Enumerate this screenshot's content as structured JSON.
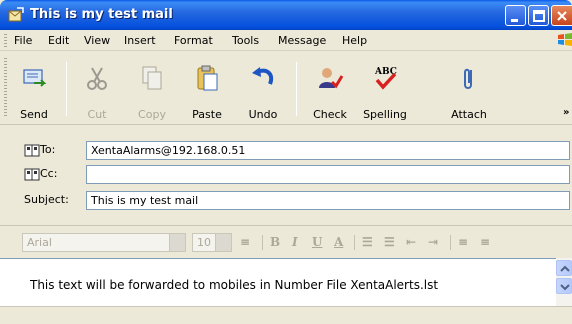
{
  "window": {
    "title": "This is my test mail"
  },
  "menu": {
    "items": [
      {
        "label": "File"
      },
      {
        "label": "Edit"
      },
      {
        "label": "View"
      },
      {
        "label": "Insert"
      },
      {
        "label": "Format"
      },
      {
        "label": "Tools"
      },
      {
        "label": "Message"
      },
      {
        "label": "Help"
      }
    ]
  },
  "toolbar": {
    "send": "Send",
    "cut": "Cut",
    "copy": "Copy",
    "paste": "Paste",
    "undo": "Undo",
    "check": "Check",
    "spelling": "Spelling",
    "spelling_icon_text": "ABC",
    "attach": "Attach"
  },
  "headers": {
    "to_label": "To:",
    "to_value": "XentaAlarms@192.168.0.51",
    "cc_label": "Cc:",
    "cc_value": "",
    "subject_label": "Subject:",
    "subject_value": "This is my test mail"
  },
  "format": {
    "font": "Arial",
    "size": "10"
  },
  "message": {
    "body": "This text will be forwarded to mobiles in Number File XentaAlerts.lst"
  },
  "colors": {
    "titlebar": "#0551de",
    "chrome": "#ece9d8",
    "field_border": "#7f9db9"
  }
}
